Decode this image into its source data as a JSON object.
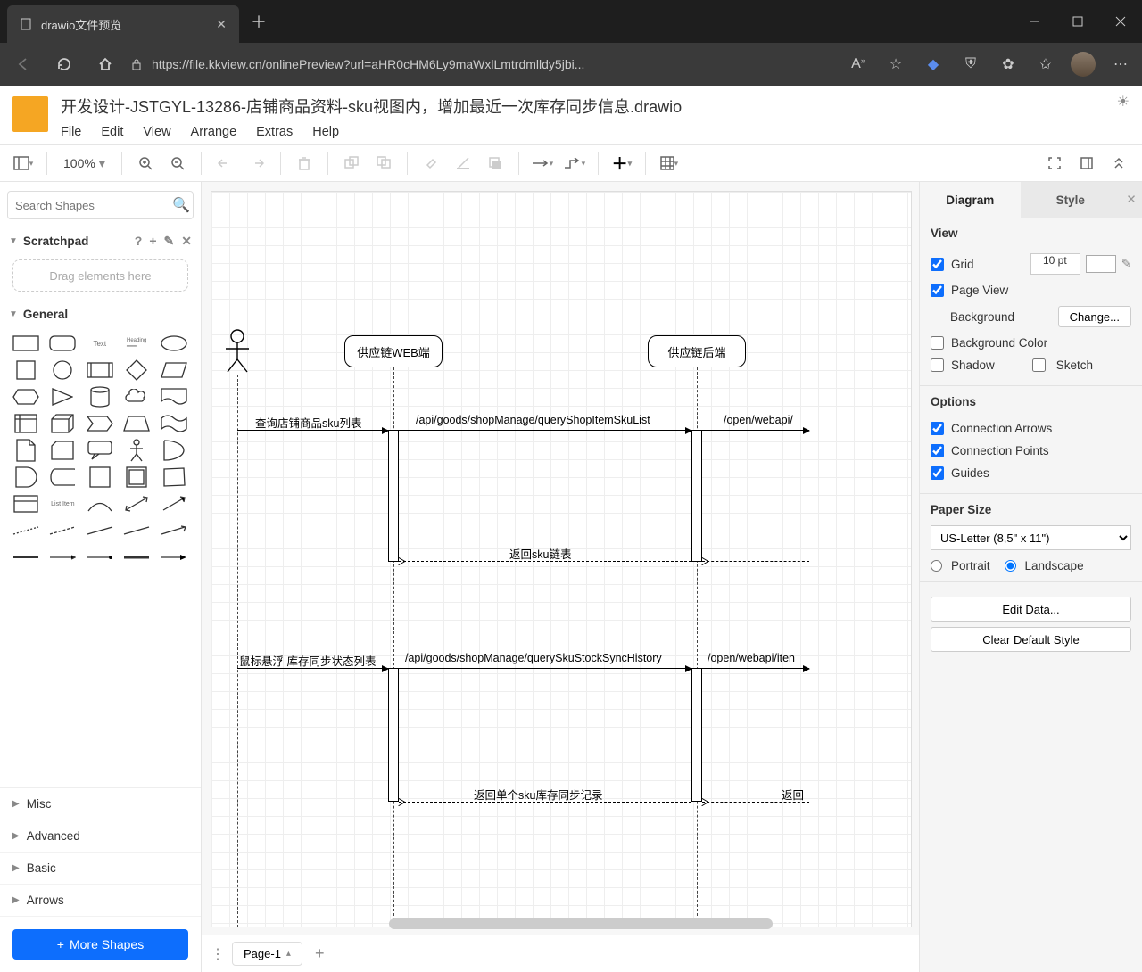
{
  "browser": {
    "tab_title": "drawio文件预览",
    "url": "https://file.kkview.cn/onlinePreview?url=aHR0cHM6Ly9maWxlLmtrdmlldy5jbi..."
  },
  "doc": {
    "title": "开发设计-JSTGYL-13286-店铺商品资料-sku视图内，增加最近一次库存同步信息.drawio",
    "menus": [
      "File",
      "Edit",
      "View",
      "Arrange",
      "Extras",
      "Help"
    ],
    "zoom": "100%"
  },
  "left": {
    "search_placeholder": "Search Shapes",
    "scratchpad": "Scratchpad",
    "drop_hint": "Drag elements here",
    "general": "General",
    "categories": [
      "Misc",
      "Advanced",
      "Basic",
      "Arrows"
    ],
    "more": "More Shapes"
  },
  "diagram": {
    "actor": "",
    "box_web": "供应链WEB端",
    "box_backend": "供应链后端",
    "msg1": "查询店铺商品sku列表",
    "api1": "/api/goods/shopManage/queryShopItemSkuList",
    "open1": "/open/webapi/",
    "ret1": "返回sku链表",
    "msg2": "鼠标悬浮 库存同步状态列表",
    "api2": "/api/goods/shopManage/querySkuStockSyncHistory",
    "open2": "/open/webapi/iten",
    "ret2": "返回单个sku库存同步记录",
    "ret3": "返回"
  },
  "pages": {
    "page1": "Page-1"
  },
  "right": {
    "tab_diagram": "Diagram",
    "tab_style": "Style",
    "view": "View",
    "grid": "Grid",
    "grid_val": "10 pt",
    "pageview": "Page View",
    "background": "Background",
    "change": "Change...",
    "bgcolor": "Background Color",
    "shadow": "Shadow",
    "sketch": "Sketch",
    "options": "Options",
    "conn_arrows": "Connection Arrows",
    "conn_points": "Connection Points",
    "guides": "Guides",
    "papersize": "Paper Size",
    "paper_val": "US-Letter (8,5\" x 11\")",
    "portrait": "Portrait",
    "landscape": "Landscape",
    "editdata": "Edit Data...",
    "cleardef": "Clear Default Style"
  }
}
